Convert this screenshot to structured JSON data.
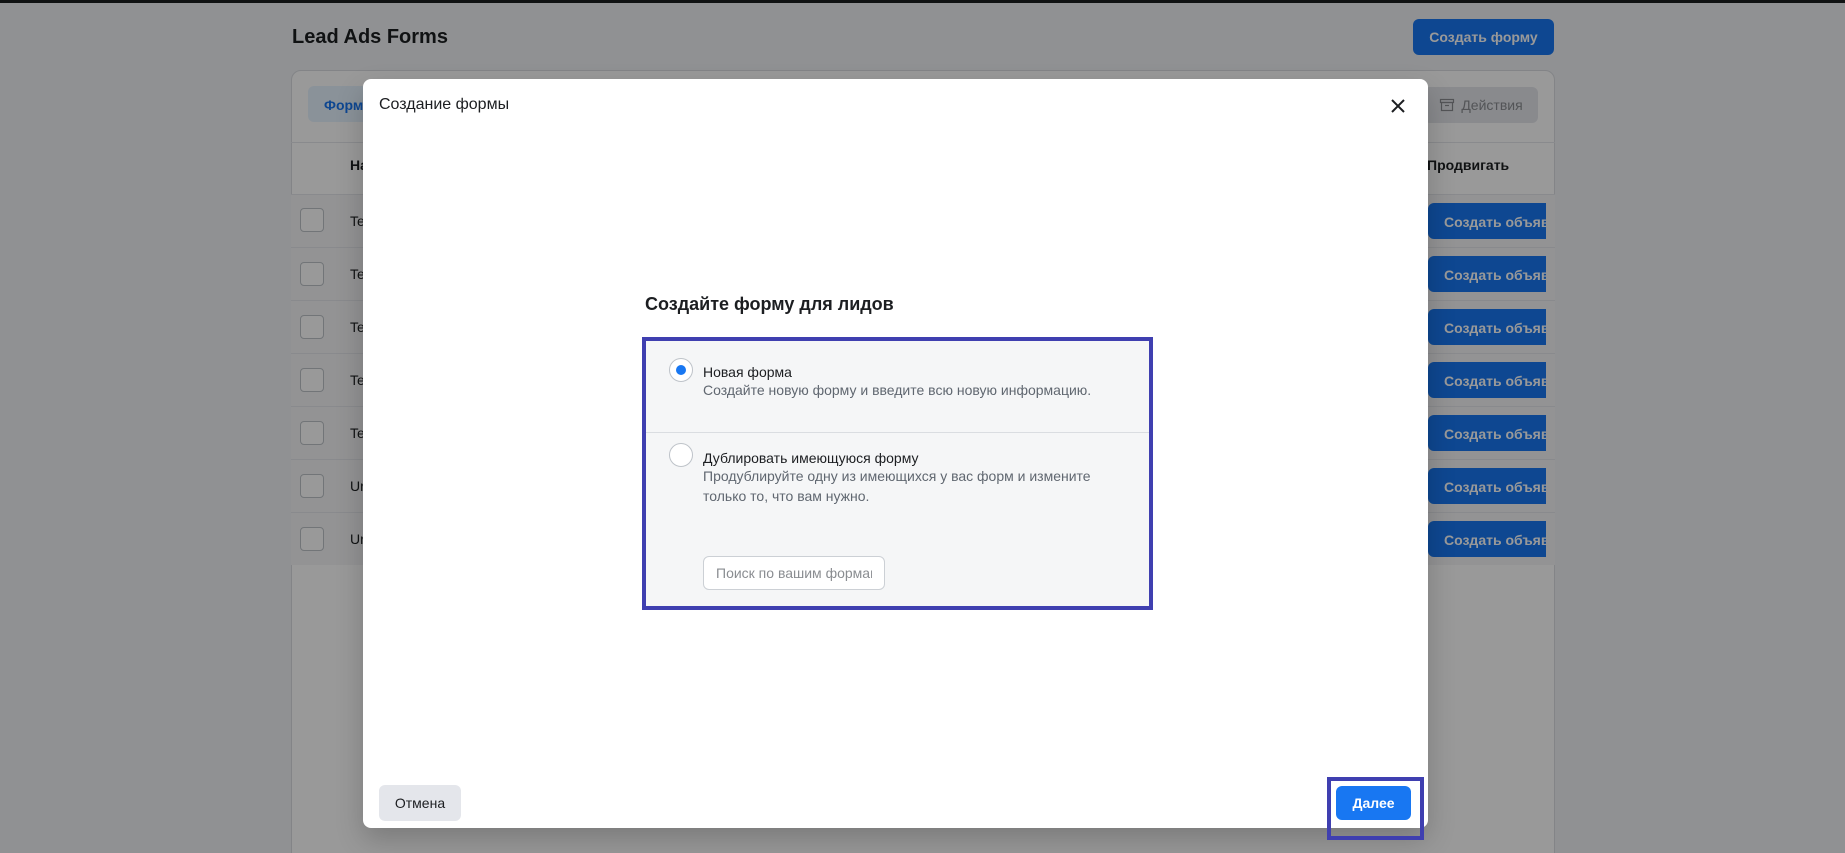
{
  "page": {
    "title": "Lead Ads Forms",
    "create_form_label": "Создать форму",
    "tab_forms_label": "Форм",
    "actions_label": "Действия",
    "columns": {
      "name": "На",
      "promote": "Продвигать"
    },
    "rows": [
      {
        "name": "Te",
        "button": "Создать объяв"
      },
      {
        "name": "Te",
        "button": "Создать объяв"
      },
      {
        "name": "Te",
        "button": "Создать объяв"
      },
      {
        "name": "Te",
        "button": "Создать объяв"
      },
      {
        "name": "Te",
        "button": "Создать объяв"
      },
      {
        "name": "Ur",
        "button": "Создать объяв"
      },
      {
        "name": "Ur",
        "button": "Создать объяв"
      }
    ]
  },
  "modal": {
    "title": "Создание формы",
    "section_title": "Создайте форму для лидов",
    "options": [
      {
        "label": "Новая форма",
        "description": "Создайте новую форму и введите всю новую информацию.",
        "selected": true
      },
      {
        "label": "Дублировать имеющуюся форму",
        "description": "Продублируйте одну из имеющихся у вас форм и измените только то, что вам нужно.",
        "selected": false
      }
    ],
    "search_placeholder": "Поиск по вашим формам",
    "cancel_label": "Отмена",
    "next_label": "Далее"
  },
  "icons": {
    "close": "close-icon",
    "actions": "archive-icon"
  },
  "colors": {
    "accent": "#1877f2",
    "highlight_frame": "#3f3fb0"
  }
}
